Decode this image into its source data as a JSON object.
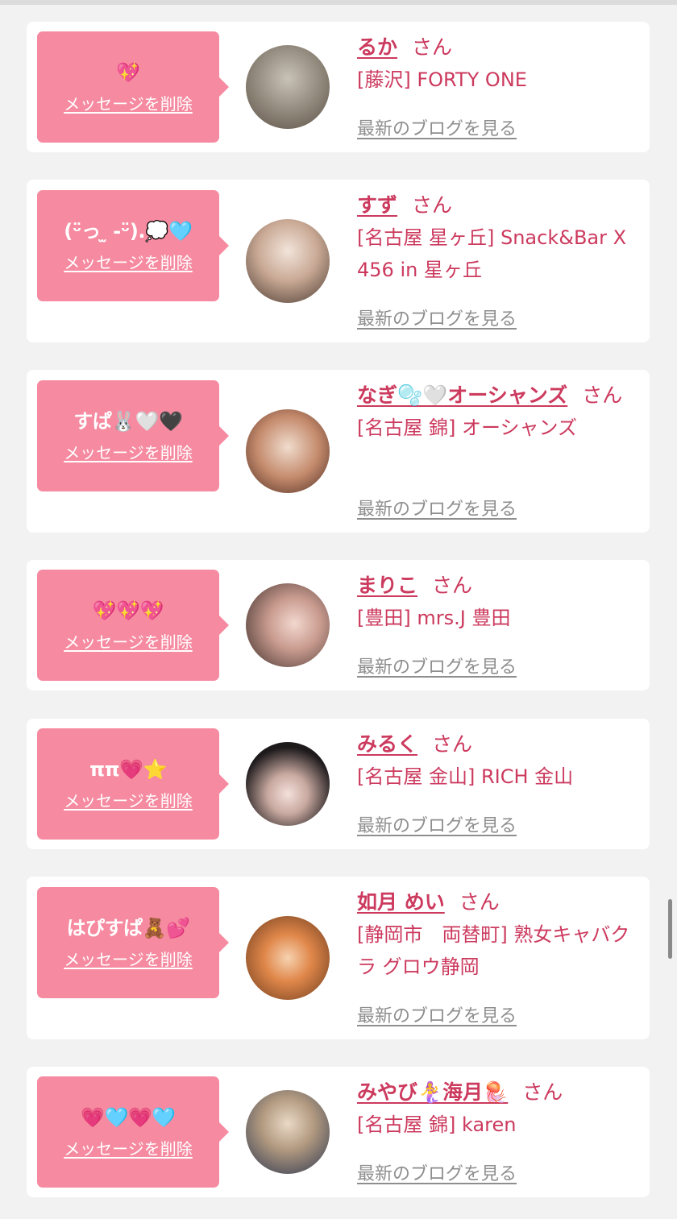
{
  "labels": {
    "delete": "メッセージを削除",
    "blog": "最新のブログを見る",
    "honorific": "さん"
  },
  "items": [
    {
      "message": "💖",
      "name": "るか",
      "shop": "[藤沢] FORTY ONE",
      "avatar": {
        "icon": "avatar-photo",
        "colors": [
          "#6b5a4a",
          "#c9c2b6"
        ]
      }
    },
    {
      "message": "(ᵕ̈っ ̫ -ᵕ̈).💭🩵",
      "name": "すず",
      "shop": "[名古屋 星ヶ丘] Snack&Bar X 456 in 星ヶ丘",
      "avatar": {
        "icon": "avatar-photo",
        "colors": [
          "#4a3a30",
          "#e9d3c4"
        ]
      }
    },
    {
      "message": "すぱ🐰🤍🖤",
      "name": "なぎ🫧🤍オーシャンズ",
      "shop": "[名古屋 錦] オーシャンズ",
      "avatar": {
        "icon": "avatar-photo",
        "colors": [
          "#7a4a38",
          "#e2b59a"
        ]
      }
    },
    {
      "message": "💖💖💖",
      "name": "まりこ",
      "shop": "[豊田] mrs.J 豊田",
      "avatar": {
        "icon": "avatar-photo",
        "colors": [
          "#3a2c28",
          "#e8c8bf"
        ]
      }
    },
    {
      "message": "ππ💗⭐",
      "name": "みるく",
      "shop": "[名古屋 金山] RICH 金山",
      "avatar": {
        "icon": "avatar-photo",
        "colors": [
          "#1e1a1c",
          "#f0d8d2"
        ]
      }
    },
    {
      "message": "はぴすぱ🧸💕",
      "name": "如月 めい",
      "shop": "[静岡市　両替町] 熟女キャバクラ グロウ静岡",
      "avatar": {
        "icon": "avatar-photo",
        "colors": [
          "#6a3a1c",
          "#e89a5a"
        ]
      }
    },
    {
      "message": "💗🩵💗🩵",
      "name": "みやび🧜‍♀️海月🪼",
      "shop": "[名古屋 錦] karen",
      "avatar": {
        "icon": "avatar-photo",
        "colors": [
          "#2c3650",
          "#d7c2a8"
        ]
      }
    }
  ]
}
